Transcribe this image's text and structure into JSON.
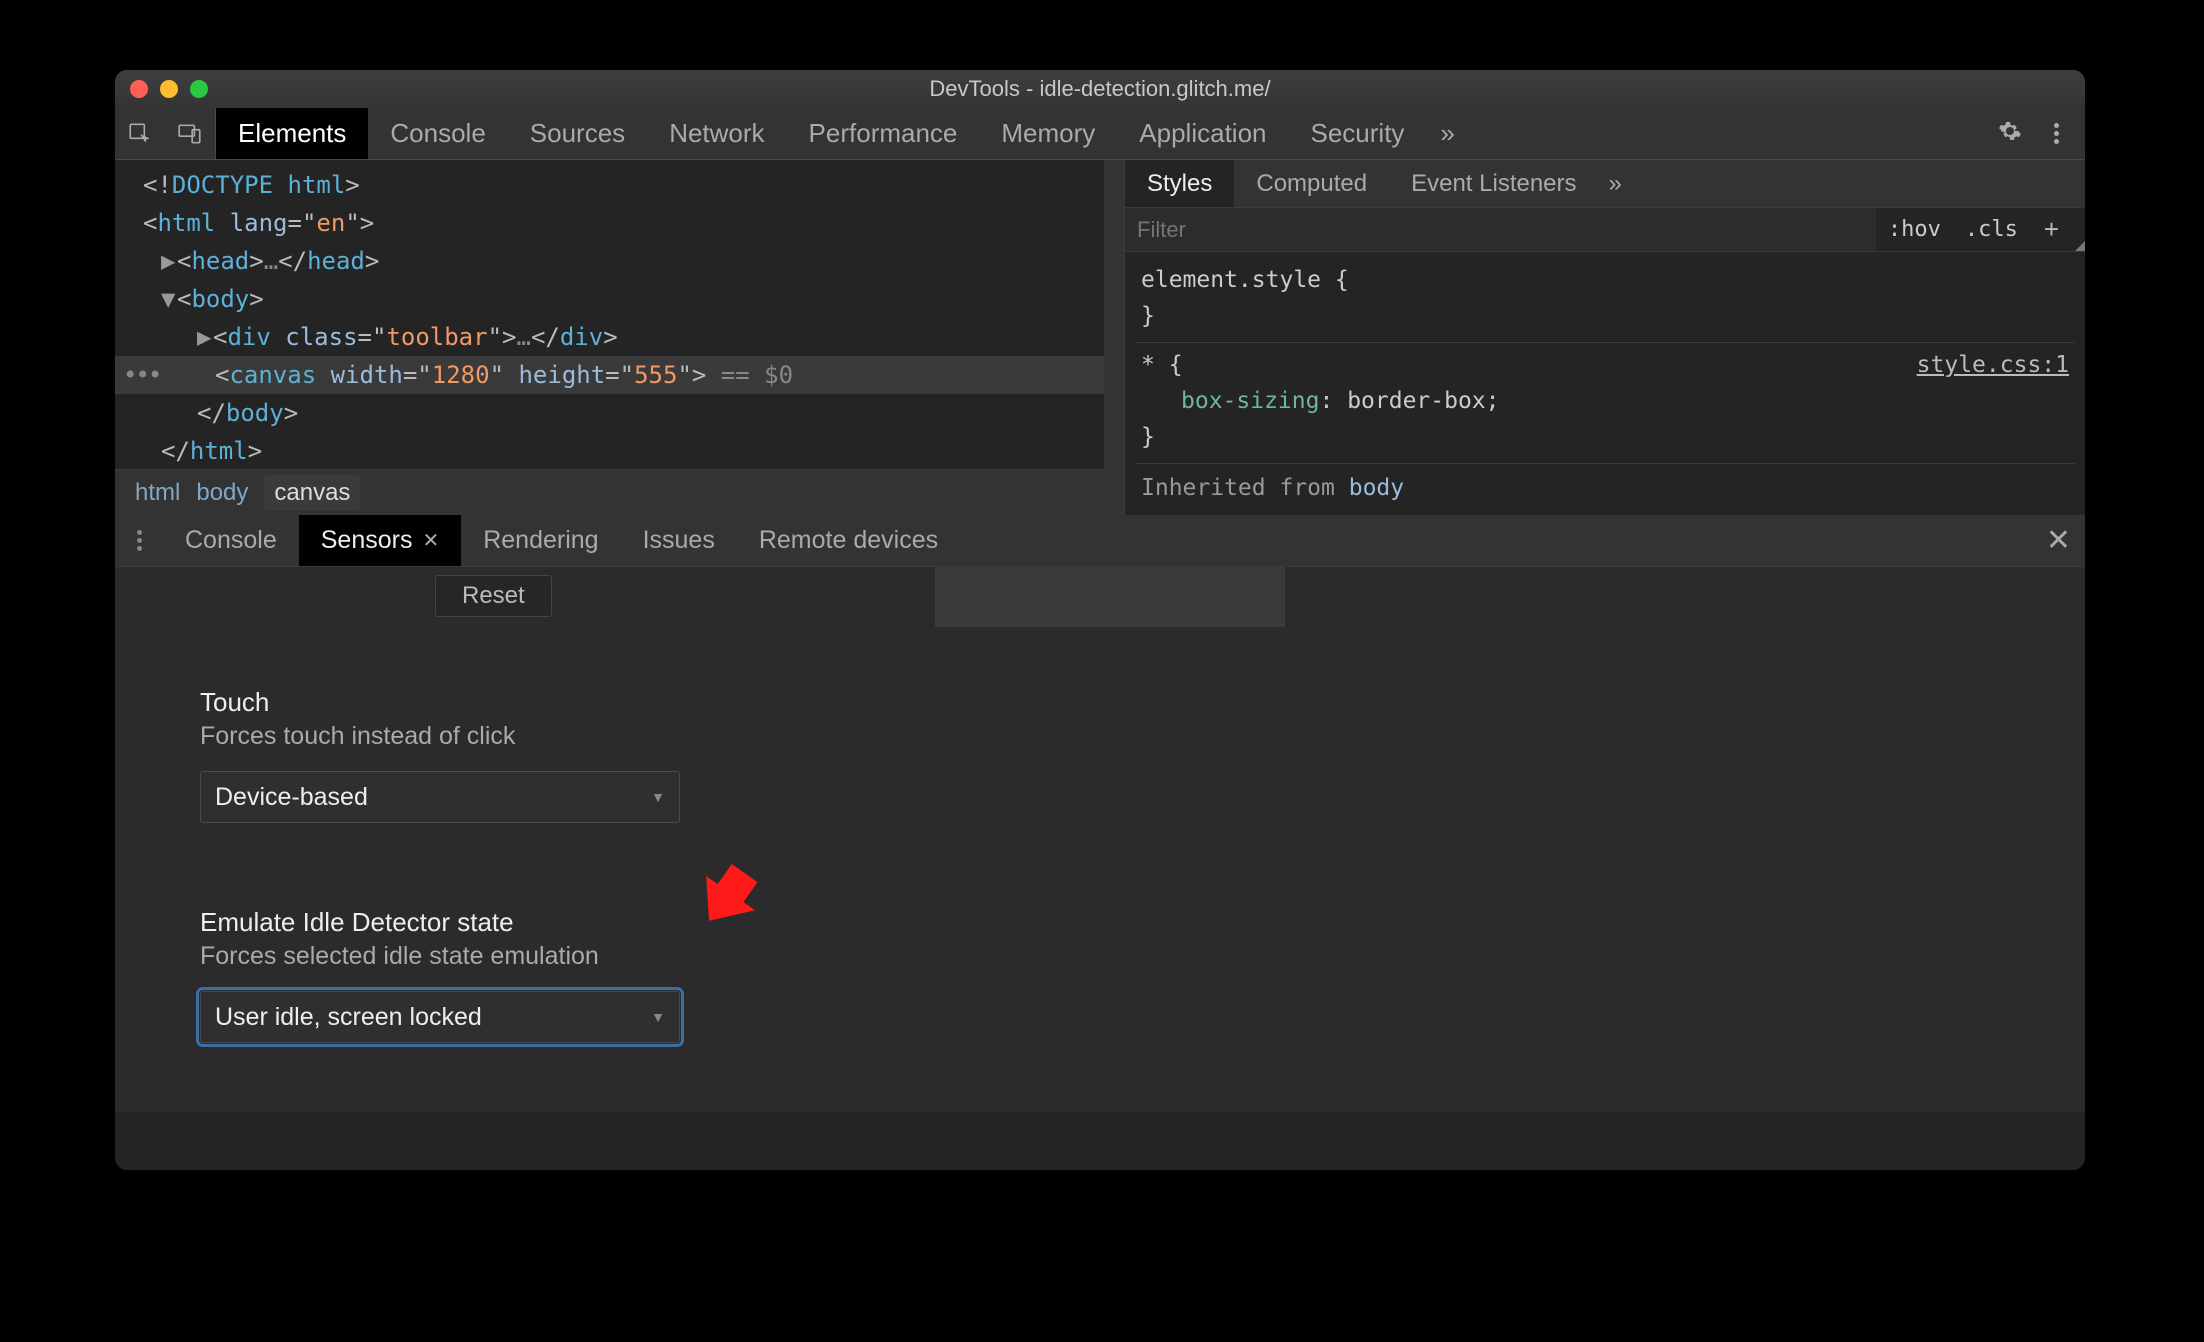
{
  "window": {
    "title": "DevTools - idle-detection.glitch.me/"
  },
  "main_tabs": [
    "Elements",
    "Console",
    "Sources",
    "Network",
    "Performance",
    "Memory",
    "Application",
    "Security"
  ],
  "main_tabs_active": "Elements",
  "overflow_glyph": "»",
  "dom": {
    "doctype": "<!DOCTYPE html>",
    "html_open": "<html lang=\"en\">",
    "head": "<head>…</head>",
    "body_open": "<body>",
    "div": "<div class=\"toolbar\">…</div>",
    "canvas_open": "<canvas width=\"1280\" height=\"555\">",
    "canvas_sv": " == $0",
    "body_close": "</body>",
    "html_close": "</html>"
  },
  "breadcrumbs": [
    "html",
    "body",
    "canvas"
  ],
  "styles_tabs": [
    "Styles",
    "Computed",
    "Event Listeners"
  ],
  "styles_tabs_active": "Styles",
  "styles_filter_placeholder": "Filter",
  "styles_pills": {
    "hov": ":hov",
    "cls": ".cls"
  },
  "css": {
    "block1_open": "element.style {",
    "block1_close": "}",
    "block2_sel": "* {",
    "block2_link": "style.css:1",
    "block2_prop": "box-sizing",
    "block2_val": "border-box",
    "block2_close": "}",
    "inherited": "Inherited from ",
    "inherited_tag": "body"
  },
  "drawer_tabs": [
    "Console",
    "Sensors",
    "Rendering",
    "Issues",
    "Remote devices"
  ],
  "drawer_tabs_active": "Sensors",
  "reset_label": "Reset",
  "touch_section": {
    "title": "Touch",
    "subtitle": "Forces touch instead of click",
    "value": "Device-based"
  },
  "idle_section": {
    "title": "Emulate Idle Detector state",
    "subtitle": "Forces selected idle state emulation",
    "value": "User idle, screen locked"
  }
}
